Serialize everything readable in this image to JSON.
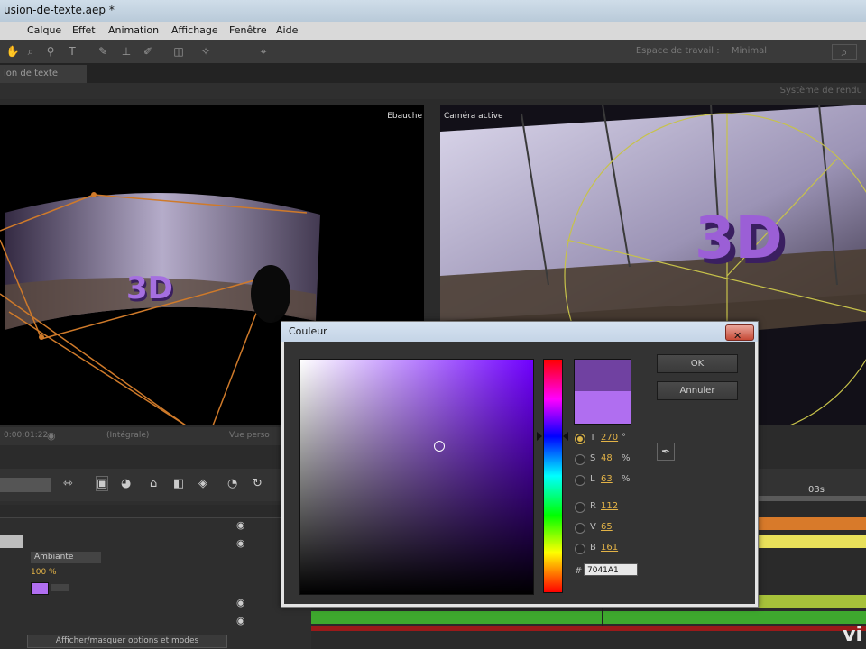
{
  "window": {
    "title": "usion-de-texte.aep *"
  },
  "menu": [
    "Calque",
    "Effet",
    "Animation",
    "Affichage",
    "Fenêtre",
    "Aide"
  ],
  "toolbar": {
    "workspace_label": "Espace de travail :",
    "workspace_value": "Minimal"
  },
  "tabs": {
    "comp_tab": "ion de texte"
  },
  "subbar": {
    "render_system": "Système de rendu"
  },
  "viewers": {
    "left_label": "Ebauche",
    "right_label": "Caméra active",
    "left_3d_text": "3D",
    "right_3d_text": "3D"
  },
  "viewer_bar": {
    "time": "0:00:01:22",
    "zoom": "(Intégrale)",
    "view": "Vue perso"
  },
  "timeline": {
    "time_marker": "03s",
    "layer_mode": "Ambiante",
    "opacity": "100 %",
    "toggle_label": "Afficher/masquer options et modes"
  },
  "dialog": {
    "title": "Couleur",
    "ok_label": "OK",
    "cancel_label": "Annuler",
    "hsl_rgb": [
      {
        "label": "T",
        "value": "270",
        "unit": "°",
        "selected": true
      },
      {
        "label": "S",
        "value": "48",
        "unit": "%",
        "selected": false
      },
      {
        "label": "L",
        "value": "63",
        "unit": "%",
        "selected": false
      },
      {
        "label": "R",
        "value": "112",
        "unit": "",
        "selected": false
      },
      {
        "label": "V",
        "value": "65",
        "unit": "",
        "selected": false
      },
      {
        "label": "B",
        "value": "161",
        "unit": "",
        "selected": false
      }
    ],
    "hex_label": "#",
    "hex_value": "7041A1",
    "new_color": "#7041a1",
    "old_color": "#b06ef0"
  },
  "colors": {
    "accent": "#e3b347",
    "layer_purple": "#b06ef0"
  }
}
